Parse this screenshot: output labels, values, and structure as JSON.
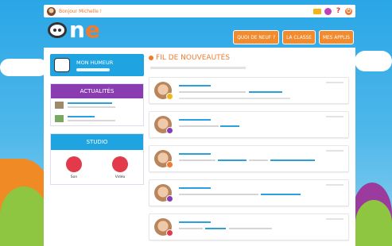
{
  "topbar": {
    "greeting": "Bonjour Michelle !",
    "icons": [
      "mail-icon",
      "user-icon",
      "help-icon",
      "power-icon"
    ]
  },
  "logo": {
    "part1": "n",
    "part2": "e"
  },
  "nav": [
    "QUOI DE NEUF ?",
    "LA CLASSE",
    "MES APPLIS"
  ],
  "left": {
    "mood_title": "MON HUMEUR",
    "actualites_title": "ACTUALITÉS",
    "studio_title": "STUDIO",
    "studio_buttons": [
      "Son",
      "Vidéo"
    ]
  },
  "feed": {
    "title": "FIL DE NOUVEAUTÉS"
  },
  "colors": {
    "orange": "#ef7b2e",
    "blue": "#1fa3e1",
    "purple": "#8a3db0",
    "red": "#e23a4a"
  }
}
